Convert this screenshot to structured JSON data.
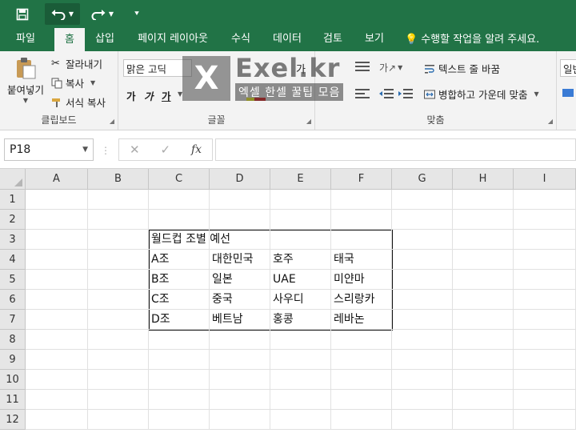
{
  "qat": {
    "save_icon": "save-icon",
    "undo_icon": "undo-icon",
    "redo_icon": "redo-icon",
    "customize_icon": "customize-qat-icon"
  },
  "tabs": [
    {
      "label": "파일",
      "active": false
    },
    {
      "label": "홈",
      "active": true
    },
    {
      "label": "삽입",
      "active": false
    },
    {
      "label": "페이지 레이아웃",
      "active": false
    },
    {
      "label": "수식",
      "active": false
    },
    {
      "label": "데이터",
      "active": false
    },
    {
      "label": "검토",
      "active": false
    },
    {
      "label": "보기",
      "active": false
    }
  ],
  "tell_me": "수행할 작업을 알려 주세요.",
  "ribbon": {
    "clipboard": {
      "paste": "붙여넣기",
      "cut": "잘라내기",
      "copy": "복사",
      "format_painter": "서식 복사",
      "label": "클립보드"
    },
    "font": {
      "font_name": "맑은 고딕",
      "bold": "가",
      "italic": "가",
      "underline": "가",
      "label": "글꼴"
    },
    "alignment": {
      "wrap_text": "텍스트 줄 바꿈",
      "merge_center": "병합하고 가운데 맞춤",
      "label": "맞춤"
    },
    "number": {
      "format": "일반"
    }
  },
  "watermark": {
    "title": "Exel.kr",
    "subtitle": "엑셀 한셀 꿀팁 모음"
  },
  "formula_bar": {
    "name_box": "P18",
    "fx": "fx",
    "value": ""
  },
  "grid": {
    "columns": [
      "A",
      "B",
      "C",
      "D",
      "E",
      "F",
      "G",
      "H",
      "I"
    ],
    "rows": [
      "1",
      "2",
      "3",
      "4",
      "5",
      "6",
      "7",
      "8",
      "9",
      "10",
      "11",
      "12"
    ],
    "cells": [
      {
        "ref": "C3",
        "value": "월드컵 조별 예선"
      },
      {
        "ref": "C4",
        "value": "A조"
      },
      {
        "ref": "D4",
        "value": "대한민국"
      },
      {
        "ref": "E4",
        "value": "호주"
      },
      {
        "ref": "F4",
        "value": "태국"
      },
      {
        "ref": "C5",
        "value": "B조"
      },
      {
        "ref": "D5",
        "value": "일본"
      },
      {
        "ref": "E5",
        "value": "UAE"
      },
      {
        "ref": "F5",
        "value": "미얀마"
      },
      {
        "ref": "C6",
        "value": "C조"
      },
      {
        "ref": "D6",
        "value": "중국"
      },
      {
        "ref": "E6",
        "value": "사우디"
      },
      {
        "ref": "F6",
        "value": "스리랑카"
      },
      {
        "ref": "C7",
        "value": "D조"
      },
      {
        "ref": "D7",
        "value": "베트남"
      },
      {
        "ref": "E7",
        "value": "홍콩"
      },
      {
        "ref": "F7",
        "value": "레바논"
      }
    ]
  },
  "colors": {
    "accent": "#217346",
    "ribbon_bg": "#f3f3f3",
    "header_bg": "#e6e6e6"
  }
}
